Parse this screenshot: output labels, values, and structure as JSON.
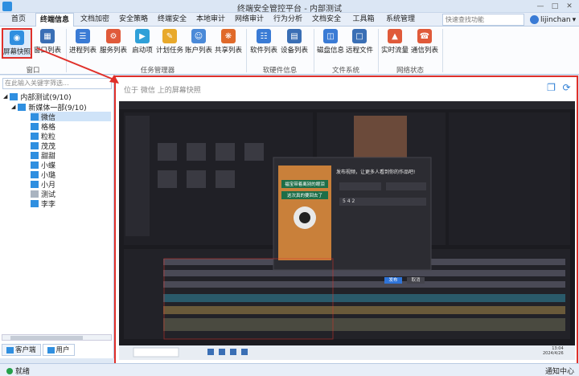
{
  "window": {
    "title": "终端安全管控平台 - 内部测试"
  },
  "tabs": [
    {
      "label": "首页"
    },
    {
      "label": "终端信息"
    },
    {
      "label": "文档加密"
    },
    {
      "label": "安全策略"
    },
    {
      "label": "终端安全"
    },
    {
      "label": "本地审计"
    },
    {
      "label": "网络审计"
    },
    {
      "label": "行为分析"
    },
    {
      "label": "文档安全"
    },
    {
      "label": "工具箱"
    },
    {
      "label": "系统管理"
    }
  ],
  "search": {
    "placeholder": "快速查找功能"
  },
  "user": {
    "name": "lijinchan"
  },
  "ribbon": {
    "buttons": [
      {
        "label": "屏幕快照",
        "icon": "camera-icon"
      },
      {
        "label": "窗口列表",
        "icon": "window-list-icon"
      },
      {
        "label": "进程列表",
        "icon": "process-list-icon"
      },
      {
        "label": "服务列表",
        "icon": "service-list-icon"
      },
      {
        "label": "启动项",
        "icon": "startup-icon"
      },
      {
        "label": "计划任务",
        "icon": "scheduled-task-icon"
      },
      {
        "label": "账户列表",
        "icon": "account-list-icon"
      },
      {
        "label": "共享列表",
        "icon": "share-list-icon"
      },
      {
        "label": "软件列表",
        "icon": "software-list-icon"
      },
      {
        "label": "设备列表",
        "icon": "device-list-icon"
      },
      {
        "label": "磁盘信息",
        "icon": "disk-icon"
      },
      {
        "label": "远程文件",
        "icon": "remote-file-icon"
      },
      {
        "label": "实时流量",
        "icon": "traffic-chart-icon"
      },
      {
        "label": "通信列表",
        "icon": "phone-icon"
      }
    ],
    "groups": [
      {
        "label": "窗口"
      },
      {
        "label": "任务管理器"
      },
      {
        "label": "软硬件信息"
      },
      {
        "label": "文件系统"
      },
      {
        "label": "网络状态"
      }
    ]
  },
  "tree": {
    "filter_placeholder": "在此输入关键字筛选...",
    "root": "内部测试(9/10)",
    "group": "新媒体一部(9/10)",
    "members": [
      "微信",
      "格格",
      "粒粒",
      "茂茂",
      "甜甜",
      "小蝶",
      "小璐",
      "小月",
      "测试",
      "李李"
    ]
  },
  "bottom_tabs": [
    {
      "label": "客户端"
    },
    {
      "label": "用户"
    }
  ],
  "main": {
    "heading": "位于 微信 上的屏幕快照",
    "screenshot": {
      "dialog_title": "发布视频，让更多人看到你的作品吧!",
      "poster_line1": "福宝带着离别的眼泪",
      "poster_line2": "这次真的要回去了",
      "btn_publish": "发布",
      "btn_cancel": "取消",
      "caption_num": "5 4 2",
      "taskbar_time": "13:04",
      "taskbar_date": "2024/4/26"
    }
  },
  "status": {
    "text": "就绪",
    "notice": "通知中心"
  },
  "colors": {
    "accent": "#2f8fe0",
    "highlight": "#e0302a",
    "panel_bg": "#dfe9f5"
  }
}
